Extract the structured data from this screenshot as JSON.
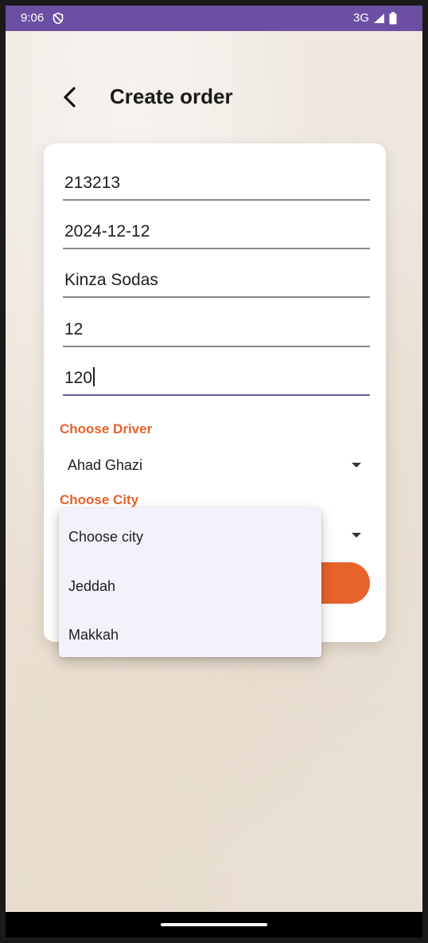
{
  "status_bar": {
    "time": "9:06",
    "network": "3G",
    "icons": [
      "do-not-disturb-icon",
      "signal-icon",
      "battery-icon"
    ]
  },
  "header": {
    "title": "Create order",
    "back_icon": "chevron-left-icon"
  },
  "form": {
    "fields": [
      {
        "value": "213213"
      },
      {
        "value": "2024-12-12"
      },
      {
        "value": "Kinza Sodas"
      },
      {
        "value": "12"
      },
      {
        "value": "120",
        "focused": true
      }
    ],
    "driver": {
      "label": "Choose Driver",
      "selected": "Ahad Ghazi"
    },
    "city": {
      "label": "Choose City"
    },
    "submit_button": {
      "label": ""
    }
  },
  "city_menu": {
    "options": [
      {
        "label": "Choose city"
      },
      {
        "label": "Jeddah"
      },
      {
        "label": "Makkah"
      }
    ]
  },
  "colors": {
    "status_bar": "#6b4fa3",
    "accent": "#e8622c",
    "focus_underline": "#6b5ea8",
    "menu_background": "#f5f1fa"
  }
}
